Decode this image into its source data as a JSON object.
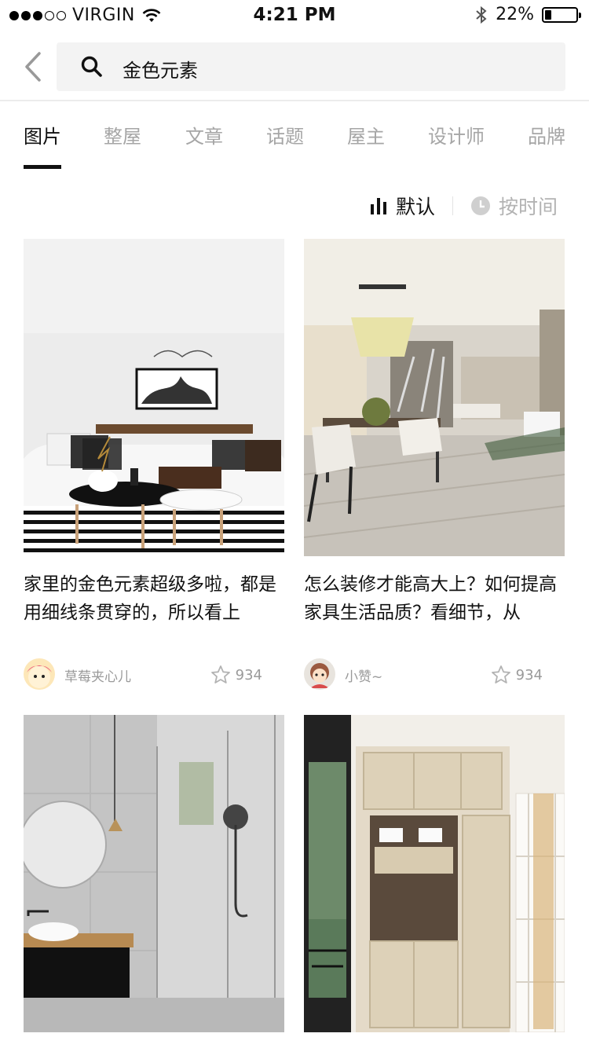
{
  "status_bar": {
    "carrier": "VIRGIN",
    "time": "4:21 PM",
    "battery": "22%",
    "battery_level": 0.22,
    "signal_bars": 3
  },
  "search": {
    "query": "金色元素"
  },
  "tabs": [
    {
      "label": "图片",
      "active": true
    },
    {
      "label": "整屋"
    },
    {
      "label": "文章"
    },
    {
      "label": "话题"
    },
    {
      "label": "屋主"
    },
    {
      "label": "设计师"
    },
    {
      "label": "品牌"
    }
  ],
  "sort": {
    "default_label": "默认",
    "time_label": "按时间"
  },
  "cards": [
    {
      "title": "家里的金色元素超级多啦，都是用细线条贯穿的，所以看上",
      "author": "草莓夹心儿",
      "likes": "934"
    },
    {
      "title": "怎么装修才能高大上？如何提高家具生活品质？看细节，从",
      "author": "小赞~",
      "likes": "934"
    },
    {},
    {}
  ],
  "colors": {
    "active_text": "#111111",
    "inactive_text": "#a6a6a6",
    "search_bg": "#f3f3f3",
    "meta_text": "#9a9a9a"
  }
}
